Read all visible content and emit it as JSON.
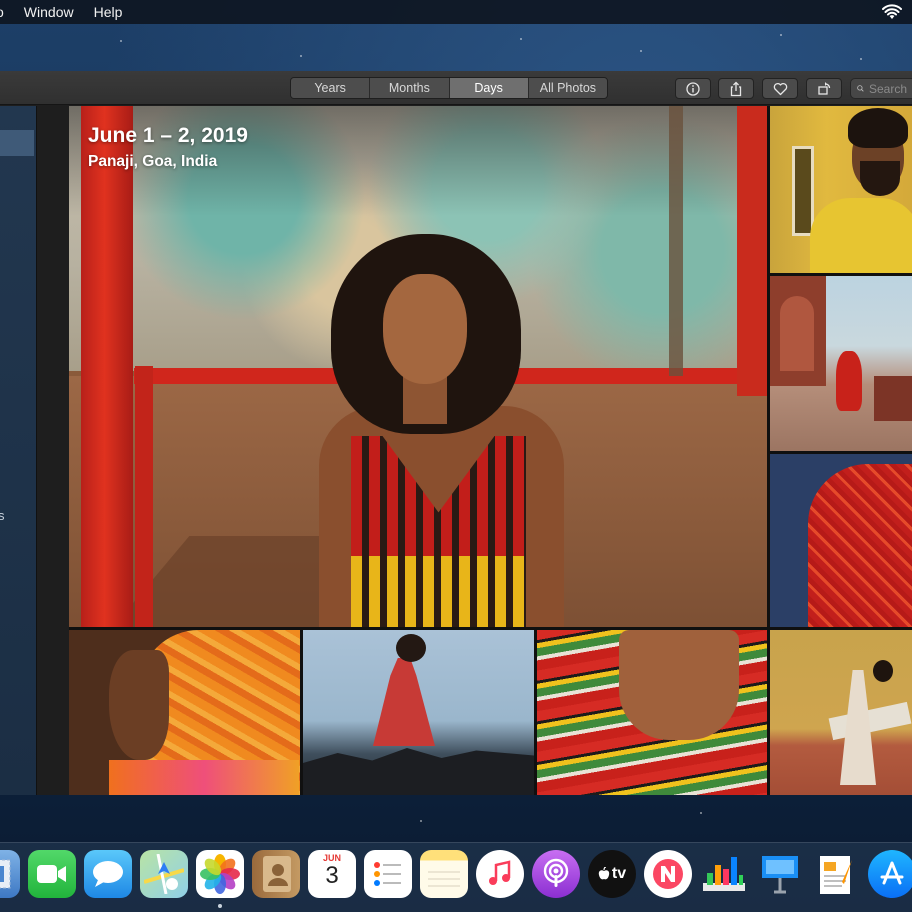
{
  "menubar": {
    "items": [
      {
        "label": "o"
      },
      {
        "label": "Window"
      },
      {
        "label": "Help"
      }
    ]
  },
  "toolbar": {
    "view_tabs": [
      {
        "label": "Years",
        "active": false
      },
      {
        "label": "Months",
        "active": false
      },
      {
        "label": "Days",
        "active": true
      },
      {
        "label": "All Photos",
        "active": false
      }
    ],
    "buttons": [
      "info-icon",
      "share-icon",
      "heart-icon",
      "rotate-icon"
    ],
    "search": {
      "placeholder": "Search",
      "value": ""
    }
  },
  "sidebar": {
    "fragment": "s"
  },
  "moment": {
    "title": "June 1 – 2, 2019",
    "location": "Panaji, Goa, India"
  },
  "dock": {
    "apps": [
      {
        "icon": "mail-stamp-icon"
      },
      {
        "icon": "facetime-icon"
      },
      {
        "icon": "messages-icon"
      },
      {
        "icon": "maps-icon"
      },
      {
        "icon": "photos-icon",
        "running": true
      },
      {
        "icon": "contacts-icon"
      },
      {
        "icon": "calendar-icon",
        "month": "JUN",
        "day": "3"
      },
      {
        "icon": "reminders-icon"
      },
      {
        "icon": "notes-icon"
      },
      {
        "icon": "music-icon"
      },
      {
        "icon": "podcasts-icon"
      },
      {
        "icon": "apple-tv-icon",
        "label": "tv"
      },
      {
        "icon": "news-icon"
      },
      {
        "icon": "numbers-icon"
      },
      {
        "icon": "keynote-icon"
      },
      {
        "icon": "pages-icon"
      },
      {
        "icon": "app-store-icon"
      }
    ]
  },
  "colors": {
    "accent_blue": "#1a8cff",
    "toolbar": "#333333",
    "active_tab": "#6f6f6f"
  }
}
